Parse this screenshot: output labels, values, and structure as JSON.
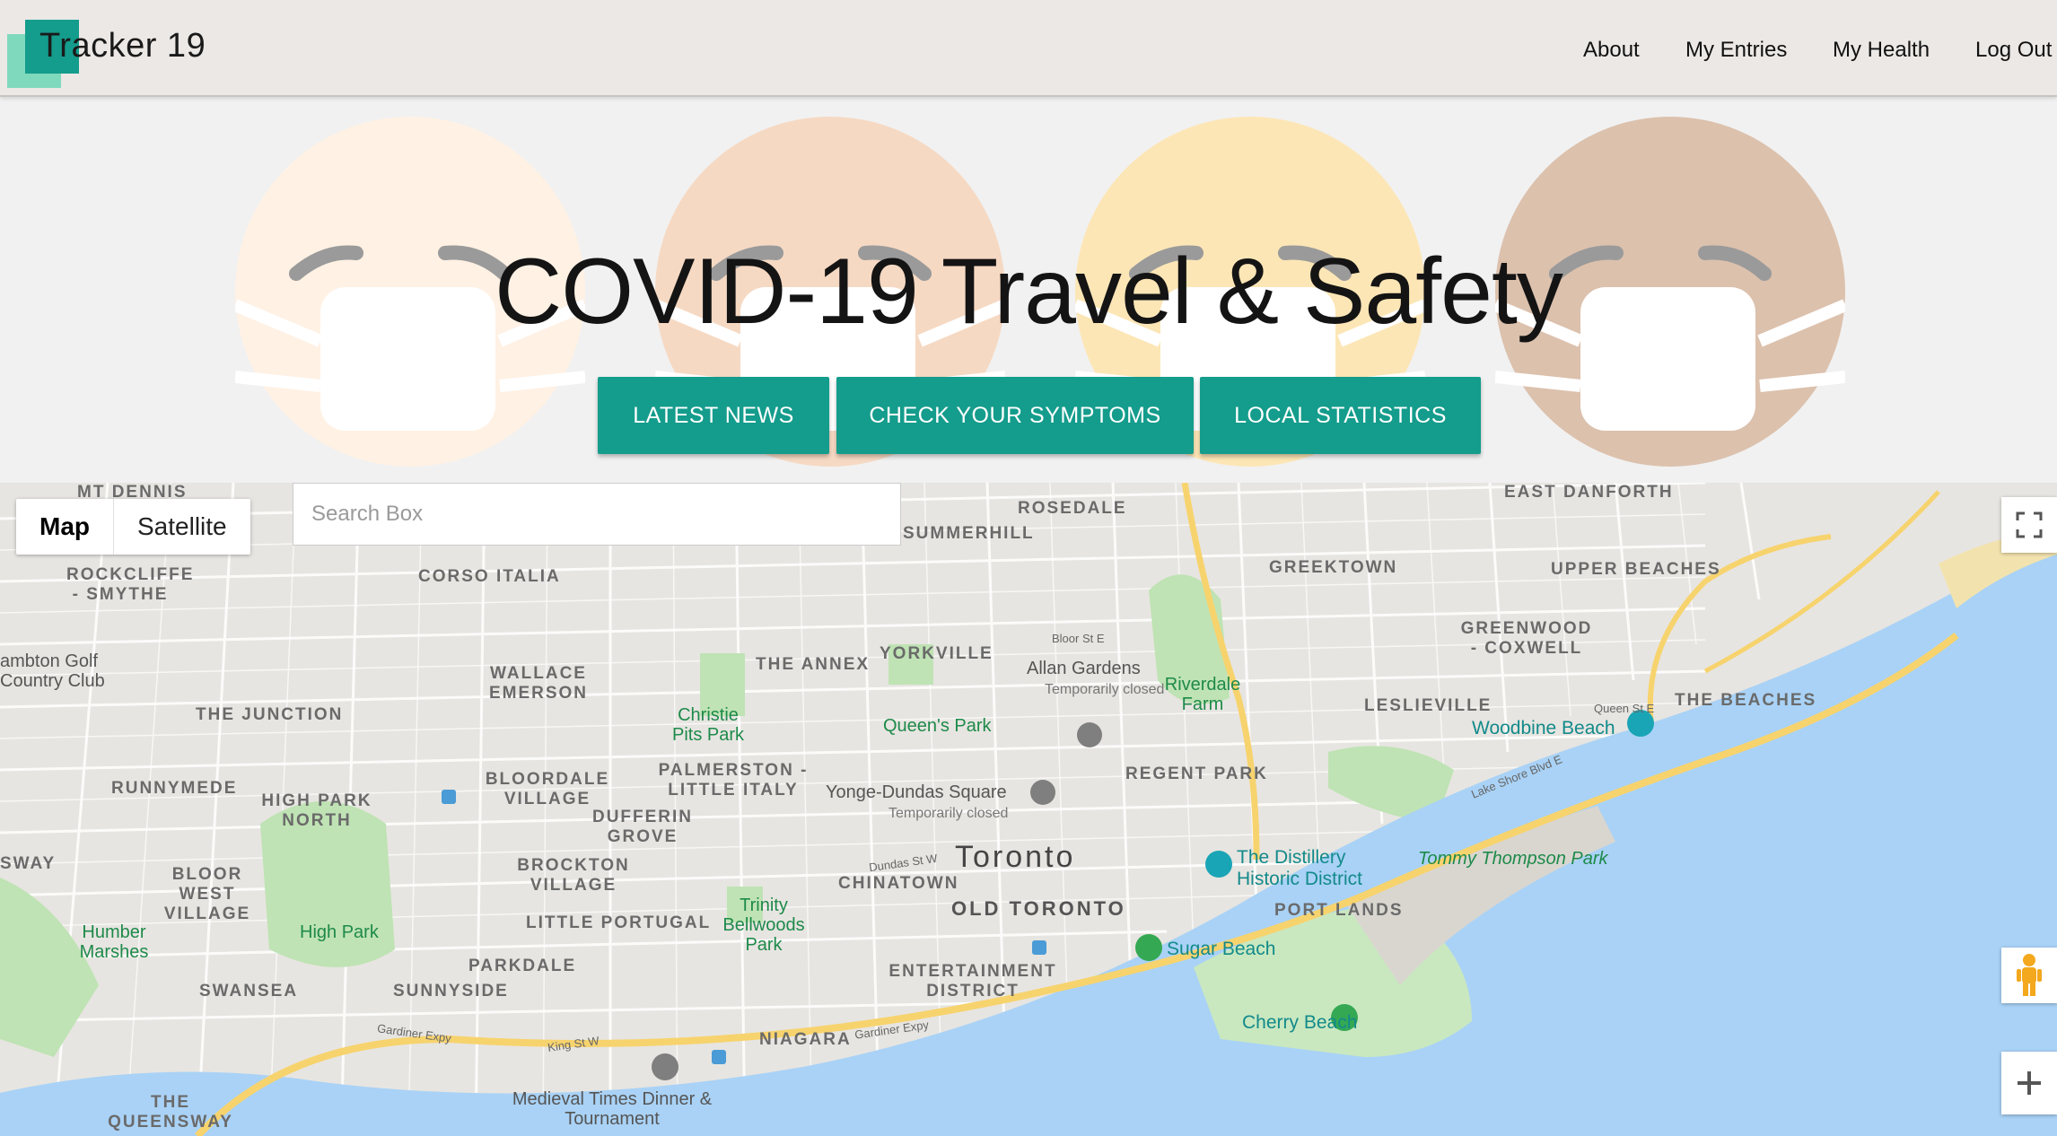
{
  "navbar": {
    "brand": "Tracker 19",
    "links": [
      "About",
      "My Entries",
      "My Health",
      "Log Out"
    ]
  },
  "hero": {
    "title": "COVID-19 Travel & Safety",
    "buttons": [
      "LATEST NEWS",
      "CHECK YOUR SYMPTOMS",
      "LOCAL STATISTICS"
    ],
    "face_colors": [
      "#fff1e4",
      "#f6d9c3",
      "#fde6b6",
      "#dcc1ad"
    ]
  },
  "map": {
    "map_types": [
      "Map",
      "Satellite"
    ],
    "search_placeholder": "Search Box",
    "city_label": "Toronto",
    "neighbourhoods": [
      "MT DENNIS",
      "ROSEDALE",
      "EAST DANFORTH",
      "ROCKCLIFFE - SMYTHE",
      "CORSO ITALIA",
      "SUMMERHILL",
      "GREEKTOWN",
      "UPPER BEACHES",
      "THE ANNEX",
      "YORKVILLE",
      "GREENWOOD - COXWELL",
      "WALLACE EMERSON",
      "THE JUNCTION",
      "LESLIEVILLE",
      "THE BEACHES",
      "PALMERSTON - LITTLE ITALY",
      "RUNNYMEDE",
      "HIGH PARK NORTH",
      "BLOORDALE VILLAGE",
      "DUFFERIN GROVE",
      "REGENT PARK",
      "SWAY",
      "BLOOR WEST VILLAGE",
      "BROCKTON VILLAGE",
      "CHINATOWN",
      "OLD TORONTO",
      "PORT LANDS",
      "LITTLE PORTUGAL",
      "PARKDALE",
      "ENTERTAINMENT DISTRICT",
      "SWANSEA",
      "SUNNYSIDE",
      "NIAGARA",
      "THE QUEENSWAY"
    ],
    "parks": [
      "Christie Pits Park",
      "Queen's Park",
      "Riverdale Farm",
      "Trinity Bellwoods Park",
      "High Park",
      "Humber Marshes"
    ],
    "pois": [
      "Allan Gardens",
      "Yonge-Dundas Square",
      "The Distillery Historic District",
      "Sugar Beach",
      "Cherry Beach",
      "Woodbine Beach",
      "Medieval Times Dinner & Tournament",
      "ambton Golf",
      "Country Club"
    ],
    "temporarily_closed": "Temporarily closed",
    "water_label": "Tommy Thompson Park",
    "roads": [
      "Gardiner Expy",
      "Lake Shore Blvd E",
      "Bloor St E",
      "Queen St E",
      "Dundas St W",
      "King St W"
    ]
  }
}
